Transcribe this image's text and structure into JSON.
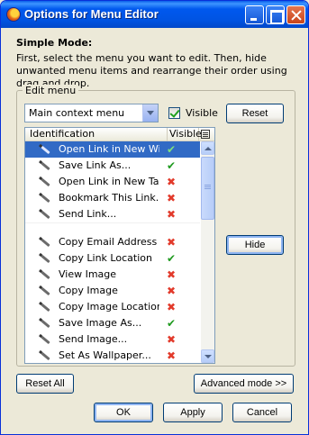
{
  "window": {
    "title": "Options for Menu Editor"
  },
  "mode": {
    "heading": "Simple Mode:",
    "description": "First, select the menu you want to edit. Then, hide unwanted menu items and rearrange their order using drag and drop."
  },
  "edit_menu": {
    "label": "Edit menu",
    "selected_menu": "Main context menu",
    "visible_checkbox": {
      "label": "Visible",
      "checked": true
    },
    "reset_label": "Reset",
    "hide_label": "Hide",
    "columns": {
      "identification": "Identification",
      "visible": "Visible"
    },
    "items": [
      {
        "label": "Open Link in New Wi...",
        "visible": "✔",
        "selected": true
      },
      {
        "label": "Save Link As...",
        "visible": "✔"
      },
      {
        "label": "Open Link in New Tab",
        "visible": "✖"
      },
      {
        "label": "Bookmark This Link...",
        "visible": "✖"
      },
      {
        "label": "Send Link...",
        "visible": "✖"
      },
      {
        "separator": true
      },
      {
        "label": "Copy Email Address",
        "visible": "✖"
      },
      {
        "label": "Copy Link Location",
        "visible": "✔"
      },
      {
        "label": "View Image",
        "visible": "✖"
      },
      {
        "label": "Copy Image",
        "visible": "✖"
      },
      {
        "label": "Copy Image Location",
        "visible": "✖"
      },
      {
        "label": "Save Image As...",
        "visible": "✔"
      },
      {
        "label": "Send Image...",
        "visible": "✖"
      },
      {
        "label": "Set As Wallpaper...",
        "visible": "✖"
      }
    ]
  },
  "footer": {
    "reset_all": "Reset All",
    "advanced": "Advanced mode >>",
    "ok": "OK",
    "apply": "Apply",
    "cancel": "Cancel"
  },
  "colors": {
    "selection": "#316ac5",
    "visible_yes": "#1f9a1f",
    "visible_no": "#e23a2b"
  },
  "icons": {
    "item": "pencil-icon",
    "column_picker": "column-picker-icon"
  }
}
